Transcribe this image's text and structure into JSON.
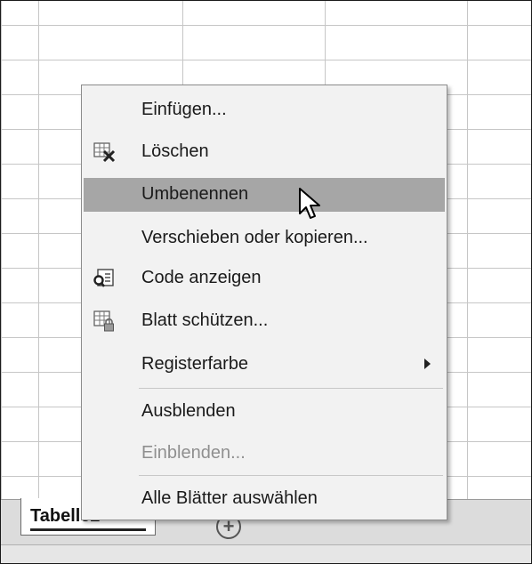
{
  "context_menu": {
    "items": [
      {
        "label": "Einfügen...",
        "icon": "",
        "submenu": false,
        "disabled": false,
        "highlighted": false
      },
      {
        "label": "Löschen",
        "icon": "delete-sheet-icon",
        "submenu": false,
        "disabled": false,
        "highlighted": false
      },
      {
        "label": "Umbenennen",
        "icon": "",
        "submenu": false,
        "disabled": false,
        "highlighted": true
      },
      {
        "label": "Verschieben oder kopieren...",
        "icon": "",
        "submenu": false,
        "disabled": false,
        "highlighted": false
      },
      {
        "label": "Code anzeigen",
        "icon": "view-code-icon",
        "submenu": false,
        "disabled": false,
        "highlighted": false
      },
      {
        "label": "Blatt schützen...",
        "icon": "protect-sheet-icon",
        "submenu": false,
        "disabled": false,
        "highlighted": false
      },
      {
        "label": "Registerfarbe",
        "icon": "",
        "submenu": true,
        "disabled": false,
        "highlighted": false
      },
      {
        "label": "Ausblenden",
        "icon": "",
        "submenu": false,
        "disabled": false,
        "highlighted": false
      },
      {
        "label": "Einblenden...",
        "icon": "",
        "submenu": false,
        "disabled": true,
        "highlighted": false
      },
      {
        "label": "Alle Blätter auswählen",
        "icon": "",
        "submenu": false,
        "disabled": false,
        "highlighted": false
      }
    ]
  },
  "sheet_tabs": {
    "active_label": "Tabelle2",
    "add_icon": "plus-circle-icon"
  },
  "colors": {
    "menu_background": "#f2f2f2",
    "highlight": "#a6a6a6",
    "disabled_text": "#8f8f8f"
  }
}
